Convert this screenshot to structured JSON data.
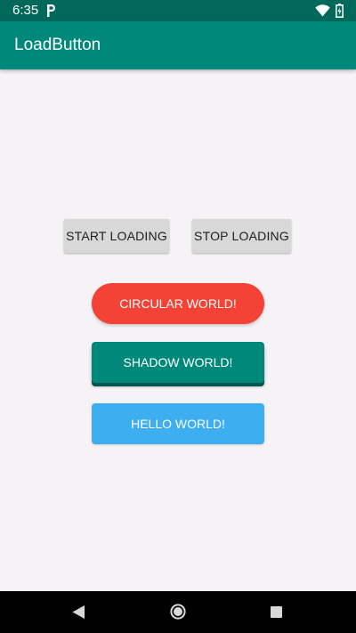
{
  "status_bar": {
    "time": "6:35",
    "icons": [
      "parking-icon",
      "wifi-icon",
      "battery-icon"
    ],
    "color": "#00695c"
  },
  "app_bar": {
    "title": "LoadButton",
    "color": "#00897b"
  },
  "buttons": {
    "start_loading": "START LOADING",
    "stop_loading": "STOP LOADING",
    "circular": "CIRCULAR WORLD!",
    "shadow": "SHADOW WORLD!",
    "hello": "HELLO WORLD!"
  },
  "colors": {
    "circular": "#f44336",
    "shadow": "#00897b",
    "hello": "#3daeef",
    "gray_button": "#d8d8d8"
  },
  "nav_bar": {
    "icons": [
      "back-icon",
      "home-icon",
      "recent-apps-icon"
    ]
  }
}
